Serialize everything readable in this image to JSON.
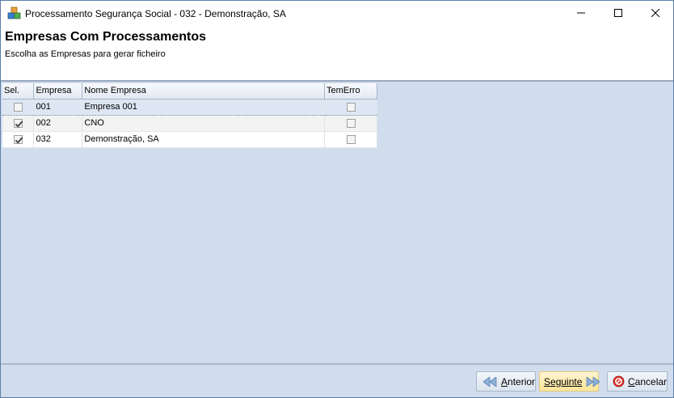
{
  "window": {
    "title": "Processamento Segurança Social - 032 - Demonstração, SA"
  },
  "header": {
    "title": "Empresas Com Processamentos",
    "subtitle": "Escolha as Empresas para gerar ficheiro"
  },
  "grid": {
    "columns": [
      "Sel.",
      "Empresa",
      "Nome Empresa",
      "TemErro"
    ],
    "rows": [
      {
        "sel": false,
        "empresa": "001",
        "nome": "Empresa 001",
        "temErro": false
      },
      {
        "sel": true,
        "empresa": "002",
        "nome": "CNO",
        "temErro": false
      },
      {
        "sel": true,
        "empresa": "032",
        "nome": "Demonstração, SA",
        "temErro": false
      }
    ]
  },
  "footer": {
    "anterior_first": "A",
    "anterior_rest": "nterior",
    "seguinte_first": "S",
    "seguinte_rest": "eguinte",
    "cancelar_first": "C",
    "cancelar_rest": "ancelar"
  },
  "icons": {
    "app": "app-cubes-icon",
    "minimize": "minimize-icon",
    "maximize": "maximize-icon",
    "close": "close-icon",
    "anterior": "arrow-left-icon",
    "seguinte": "arrow-right-icon",
    "cancelar": "cancel-icon"
  }
}
